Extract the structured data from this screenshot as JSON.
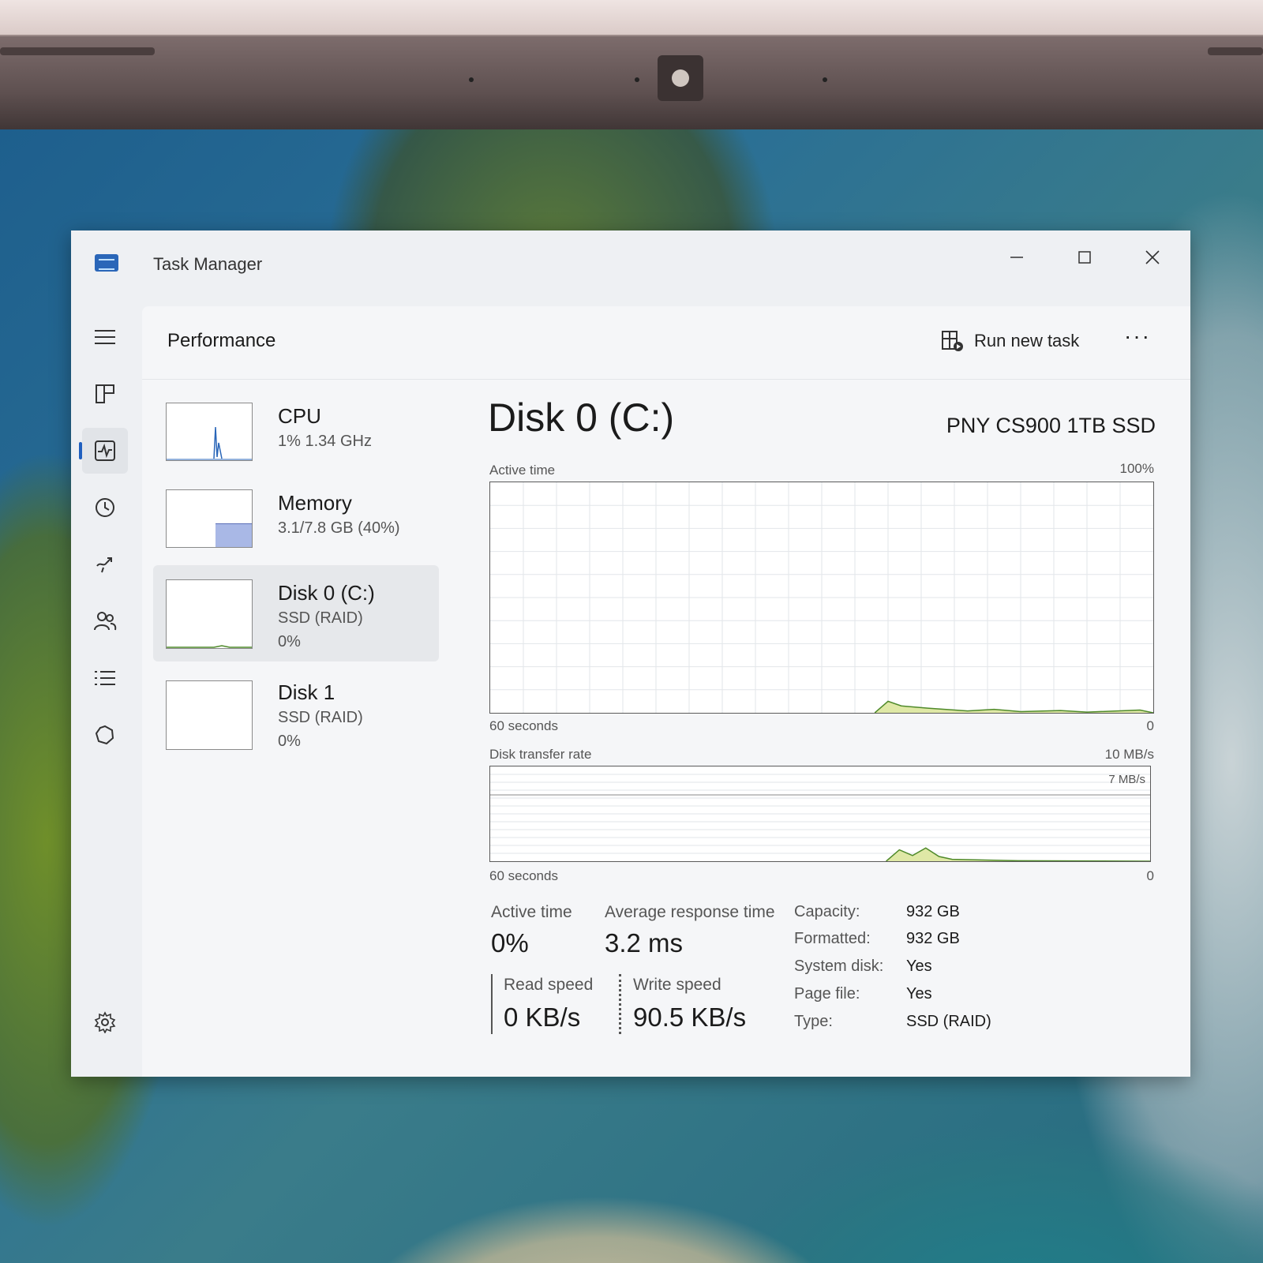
{
  "window": {
    "title": "Task Manager",
    "controls": [
      "minimize",
      "maximize",
      "close"
    ]
  },
  "header": {
    "page_title": "Performance",
    "run_new_task": "Run new task",
    "more": "···"
  },
  "sidebar": {
    "items": [
      {
        "icon": "hamburger-icon"
      },
      {
        "icon": "processes-icon"
      },
      {
        "icon": "performance-icon",
        "active": true
      },
      {
        "icon": "app-history-icon"
      },
      {
        "icon": "startup-apps-icon"
      },
      {
        "icon": "users-icon"
      },
      {
        "icon": "details-icon"
      },
      {
        "icon": "services-icon"
      },
      {
        "icon": "settings-icon"
      }
    ]
  },
  "devices": [
    {
      "name": "CPU",
      "line1": "1%  1.34 GHz",
      "line2": ""
    },
    {
      "name": "Memory",
      "line1": "3.1/7.8 GB (40%)",
      "line2": "",
      "fill": 0.4
    },
    {
      "name": "Disk 0 (C:)",
      "line1": "SSD (RAID)",
      "line2": "0%",
      "selected": true
    },
    {
      "name": "Disk 1",
      "line1": "SSD (RAID)",
      "line2": "0%"
    }
  ],
  "disk": {
    "title": "Disk 0 (C:)",
    "model": "PNY CS900 1TB SSD",
    "active_graph": {
      "label": "Active time",
      "max": "100%",
      "x_left": "60 seconds",
      "x_right": "0"
    },
    "transfer_graph": {
      "label": "Disk transfer rate",
      "max": "10 MB/s",
      "marker": "7 MB/s",
      "x_left": "60 seconds",
      "x_right": "0"
    },
    "stats": {
      "active_time_label": "Active time",
      "active_time": "0%",
      "avg_response_label": "Average response time",
      "avg_response": "3.2 ms",
      "read_label": "Read speed",
      "read": "0 KB/s",
      "write_label": "Write speed",
      "write": "90.5 KB/s"
    },
    "properties": [
      {
        "k": "Capacity:",
        "v": "932 GB"
      },
      {
        "k": "Formatted:",
        "v": "932 GB"
      },
      {
        "k": "System disk:",
        "v": "Yes"
      },
      {
        "k": "Page file:",
        "v": "Yes"
      },
      {
        "k": "Type:",
        "v": "SSD (RAID)"
      }
    ]
  },
  "colors": {
    "accent": "#1f5fbf",
    "graph_line": "#4f8a2a",
    "graph_fill": "#dfe8a6"
  }
}
